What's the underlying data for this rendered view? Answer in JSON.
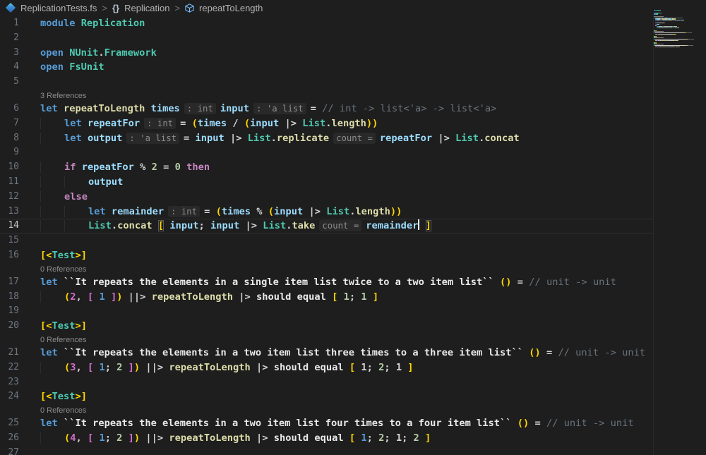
{
  "breadcrumb": {
    "file": "ReplicationTests.fs",
    "sep": ">",
    "namespace_glyph": "{}",
    "namespace_label": "Replication",
    "symbol": "repeatToLength"
  },
  "colors": {
    "kw": "#569CD6",
    "ctl": "#C586C0",
    "ty": "#4EC9B0",
    "fn": "#DCDCAA",
    "vr": "#9CDCFE",
    "wh": "#D4D4D4",
    "nm": "#E9E9E9",
    "cm": "#6A737D",
    "g1": "#FFD700",
    "g2": "#D670D6",
    "nG": "#B5CEA8",
    "nB": "#569CD6",
    "nP": "#D16DC8",
    "in": "#8D8D8D",
    "lens": "#8C8C8C",
    "editor_bg": "#1E1E1E"
  },
  "editor": {
    "rows": [
      {
        "n": "1",
        "tk": [
          [
            "module ",
            "kw"
          ],
          [
            "Replication",
            "ty"
          ]
        ]
      },
      {
        "n": "2",
        "tk": []
      },
      {
        "n": "3",
        "tk": [
          [
            "open ",
            "kw"
          ],
          [
            "NUnit",
            "ty"
          ],
          [
            ".",
            "wh"
          ],
          [
            "Framework",
            "ty"
          ]
        ]
      },
      {
        "n": "4",
        "tk": [
          [
            "open ",
            "kw"
          ],
          [
            "FsUnit",
            "ty"
          ]
        ]
      },
      {
        "n": "5",
        "tk": []
      },
      {
        "lens": "3 References"
      },
      {
        "n": "6",
        "tk": [
          [
            "let ",
            "kw"
          ],
          [
            "repeatToLength",
            "fn"
          ],
          [
            " ",
            "wh"
          ],
          [
            "times",
            "vr"
          ],
          [
            ": int",
            "in"
          ],
          [
            "input",
            "vr"
          ],
          [
            ": 'a list",
            "in"
          ],
          [
            "= ",
            "wh"
          ],
          [
            "// int -> list<'a> -> list<'a>",
            "cm"
          ]
        ]
      },
      {
        "n": "7",
        "tk": [
          [
            "    ",
            "ind"
          ],
          [
            "let ",
            "kw"
          ],
          [
            "repeatFor",
            "vr"
          ],
          [
            ": int",
            "in"
          ],
          [
            "= ",
            "wh"
          ],
          [
            "(",
            "g1"
          ],
          [
            "times",
            "vr"
          ],
          [
            " / ",
            "wh"
          ],
          [
            "(",
            "g1"
          ],
          [
            "input ",
            "vr"
          ],
          [
            "|> ",
            "wh"
          ],
          [
            "List",
            "ty"
          ],
          [
            ".",
            "wh"
          ],
          [
            "length",
            "fn"
          ],
          [
            "))",
            "g1"
          ]
        ]
      },
      {
        "n": "8",
        "tk": [
          [
            "    ",
            "ind"
          ],
          [
            "let ",
            "kw"
          ],
          [
            "output",
            "vr"
          ],
          [
            ": 'a list",
            "in"
          ],
          [
            "= ",
            "wh"
          ],
          [
            "input ",
            "vr"
          ],
          [
            "|> ",
            "wh"
          ],
          [
            "List",
            "ty"
          ],
          [
            ".",
            "wh"
          ],
          [
            "replicate",
            "fn"
          ],
          [
            "count =",
            "in"
          ],
          [
            "repeatFor ",
            "vr"
          ],
          [
            "|> ",
            "wh"
          ],
          [
            "List",
            "ty"
          ],
          [
            ".",
            "wh"
          ],
          [
            "concat",
            "fn"
          ]
        ]
      },
      {
        "n": "9",
        "tk": []
      },
      {
        "n": "10",
        "tk": [
          [
            "    ",
            "ind"
          ],
          [
            "if ",
            "ctl"
          ],
          [
            "repeatFor",
            "vr"
          ],
          [
            " % ",
            "wh"
          ],
          [
            "2",
            "nG"
          ],
          [
            " = ",
            "wh"
          ],
          [
            "0",
            "nG"
          ],
          [
            " ",
            "wh"
          ],
          [
            "then",
            "ctl"
          ]
        ]
      },
      {
        "n": "11",
        "tk": [
          [
            "    ",
            "ind"
          ],
          [
            "    ",
            "ind"
          ],
          [
            "output",
            "vr"
          ]
        ]
      },
      {
        "n": "12",
        "tk": [
          [
            "    ",
            "ind"
          ],
          [
            "else",
            "ctl"
          ]
        ]
      },
      {
        "n": "13",
        "tk": [
          [
            "    ",
            "ind"
          ],
          [
            "    ",
            "ind"
          ],
          [
            "let ",
            "kw"
          ],
          [
            "remainder",
            "vr"
          ],
          [
            ": int",
            "in"
          ],
          [
            "= ",
            "wh"
          ],
          [
            "(",
            "g1"
          ],
          [
            "times",
            "vr"
          ],
          [
            " % ",
            "wh"
          ],
          [
            "(",
            "g1"
          ],
          [
            "input ",
            "vr"
          ],
          [
            "|> ",
            "wh"
          ],
          [
            "List",
            "ty"
          ],
          [
            ".",
            "wh"
          ],
          [
            "length",
            "fn"
          ],
          [
            "))",
            "g1"
          ]
        ]
      },
      {
        "n": "14",
        "cur": true,
        "tk": [
          [
            "    ",
            "ind"
          ],
          [
            "    ",
            "ind"
          ],
          [
            "List",
            "ty"
          ],
          [
            ".",
            "wh"
          ],
          [
            "concat ",
            "fn"
          ],
          [
            "[",
            "g1 bh"
          ],
          [
            " ",
            "wh"
          ],
          [
            "input",
            "vr"
          ],
          [
            "; ",
            "wh"
          ],
          [
            "input ",
            "vr"
          ],
          [
            "|> ",
            "wh"
          ],
          [
            "List",
            "ty"
          ],
          [
            ".",
            "wh"
          ],
          [
            "take",
            "fn"
          ],
          [
            "count =",
            "in"
          ],
          [
            "remainder",
            "vr"
          ],
          [
            "",
            "cursor"
          ],
          [
            " ",
            "wh"
          ],
          [
            "]",
            "g1 bh"
          ]
        ]
      },
      {
        "n": "15",
        "tk": []
      },
      {
        "n": "16",
        "tk": [
          [
            "[<",
            "g1"
          ],
          [
            "Test",
            "ty"
          ],
          [
            ">]",
            "g1"
          ]
        ]
      },
      {
        "lens": "0 References"
      },
      {
        "n": "17",
        "tk": [
          [
            "let ",
            "kw"
          ],
          [
            "``It repeats the elements in a single item list twice to a two item list`` ",
            "nm"
          ],
          [
            "()",
            "g1"
          ],
          [
            " = ",
            "wh"
          ],
          [
            "// unit -> unit",
            "cm"
          ]
        ]
      },
      {
        "n": "18",
        "tk": [
          [
            "    ",
            "ind"
          ],
          [
            "(",
            "g1"
          ],
          [
            "2",
            "nP"
          ],
          [
            ", ",
            "wh"
          ],
          [
            "[ ",
            "g2"
          ],
          [
            "1",
            "nB"
          ],
          [
            " ",
            "wh"
          ],
          [
            "]",
            "g2"
          ],
          [
            ")",
            "g1"
          ],
          [
            " ||> ",
            "wh"
          ],
          [
            "repeatToLength ",
            "fn"
          ],
          [
            "|> ",
            "wh"
          ],
          [
            "should equal ",
            "nm"
          ],
          [
            "[ ",
            "g1"
          ],
          [
            "1",
            "nG"
          ],
          [
            "; ",
            "wh"
          ],
          [
            "1",
            "nG"
          ],
          [
            " ]",
            "g1"
          ]
        ]
      },
      {
        "n": "19",
        "tk": []
      },
      {
        "n": "20",
        "tk": [
          [
            "[<",
            "g1"
          ],
          [
            "Test",
            "ty"
          ],
          [
            ">]",
            "g1"
          ]
        ]
      },
      {
        "lens": "0 References"
      },
      {
        "n": "21",
        "tk": [
          [
            "let ",
            "kw"
          ],
          [
            "``It repeats the elements in a two item list three times to a three item list`` ",
            "nm"
          ],
          [
            "()",
            "g1"
          ],
          [
            " = ",
            "wh"
          ],
          [
            "// unit -> unit",
            "cm"
          ]
        ]
      },
      {
        "n": "22",
        "tk": [
          [
            "    ",
            "ind"
          ],
          [
            "(",
            "g1"
          ],
          [
            "3",
            "nP"
          ],
          [
            ", ",
            "wh"
          ],
          [
            "[ ",
            "g2"
          ],
          [
            "1",
            "nB"
          ],
          [
            "; ",
            "wh"
          ],
          [
            "2",
            "nG"
          ],
          [
            " ",
            "wh"
          ],
          [
            "]",
            "g2"
          ],
          [
            ")",
            "g1"
          ],
          [
            " ||> ",
            "wh"
          ],
          [
            "repeatToLength ",
            "fn"
          ],
          [
            "|> ",
            "wh"
          ],
          [
            "should equal ",
            "nm"
          ],
          [
            "[ ",
            "g1"
          ],
          [
            "1",
            "wh"
          ],
          [
            "; ",
            "wh"
          ],
          [
            "2",
            "nG"
          ],
          [
            "; ",
            "wh"
          ],
          [
            "1",
            "wh"
          ],
          [
            " ]",
            "g1"
          ]
        ]
      },
      {
        "n": "23",
        "tk": []
      },
      {
        "n": "24",
        "tk": [
          [
            "[<",
            "g1"
          ],
          [
            "Test",
            "ty"
          ],
          [
            ">]",
            "g1"
          ]
        ]
      },
      {
        "lens": "0 References"
      },
      {
        "n": "25",
        "tk": [
          [
            "let ",
            "kw"
          ],
          [
            "``It repeats the elements in a two item list four times to a four item list`` ",
            "nm"
          ],
          [
            "()",
            "g1"
          ],
          [
            " = ",
            "wh"
          ],
          [
            "// unit -> unit",
            "cm"
          ]
        ]
      },
      {
        "n": "26",
        "tk": [
          [
            "    ",
            "ind"
          ],
          [
            "(",
            "g1"
          ],
          [
            "4",
            "nP"
          ],
          [
            ", ",
            "wh"
          ],
          [
            "[ ",
            "g2"
          ],
          [
            "1",
            "nB"
          ],
          [
            "; ",
            "wh"
          ],
          [
            "2",
            "nG"
          ],
          [
            " ",
            "wh"
          ],
          [
            "]",
            "g2"
          ],
          [
            ")",
            "g1"
          ],
          [
            " ||> ",
            "wh"
          ],
          [
            "repeatToLength ",
            "fn"
          ],
          [
            "|> ",
            "wh"
          ],
          [
            "should equal ",
            "nm"
          ],
          [
            "[ ",
            "g1"
          ],
          [
            "1",
            "nB"
          ],
          [
            "; ",
            "wh"
          ],
          [
            "2",
            "nG"
          ],
          [
            "; ",
            "wh"
          ],
          [
            "1",
            "wh"
          ],
          [
            "; ",
            "wh"
          ],
          [
            "2",
            "nG"
          ],
          [
            " ]",
            "g1"
          ]
        ]
      },
      {
        "n": "27",
        "tk": []
      }
    ]
  }
}
